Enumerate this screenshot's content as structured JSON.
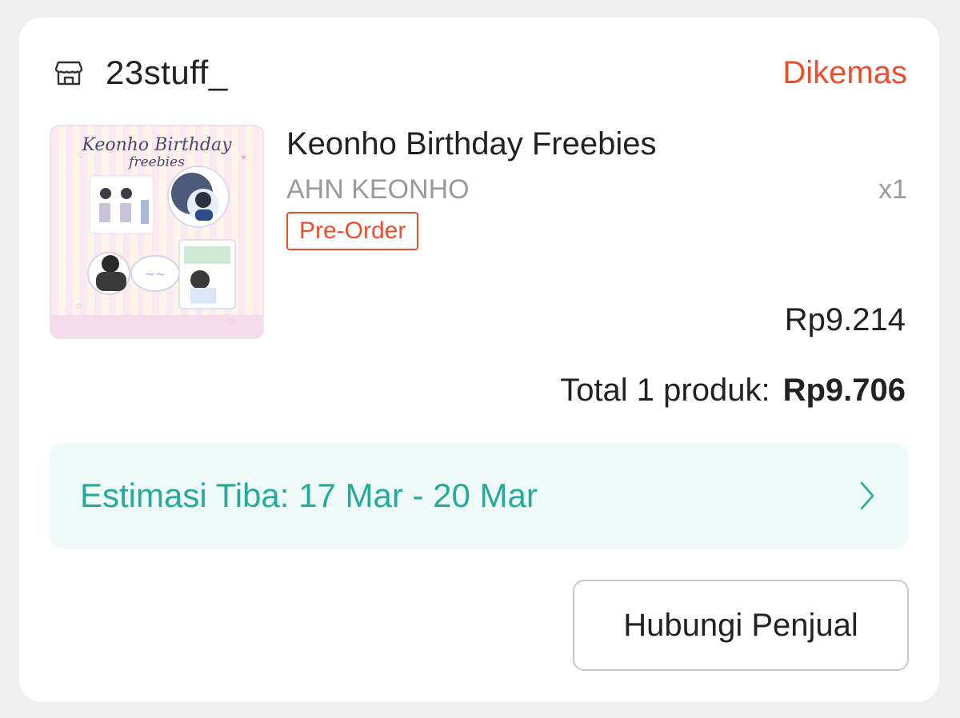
{
  "order": {
    "shop": {
      "icon": "store-icon",
      "name": "23stuff_"
    },
    "status": "Dikemas",
    "product": {
      "thumbnail_text": {
        "title_line1": "Keonho Birthday",
        "title_line2": "freebies"
      },
      "title": "Keonho Birthday Freebies",
      "variant": "AHN KEONHO",
      "quantity": "x1",
      "badge": "Pre-Order",
      "price": "Rp9.214"
    },
    "total": {
      "label": "Total 1 produk:",
      "amount": "Rp9.706"
    },
    "delivery": {
      "estimate": "Estimasi Tiba: 17 Mar - 20 Mar",
      "icon": "chevron-right-icon"
    },
    "actions": {
      "contact_seller": "Hubungi Penjual"
    }
  },
  "colors": {
    "accent": "#ee4d2d",
    "eta_text": "#26aa99",
    "eta_bg": "#eefaf7"
  }
}
